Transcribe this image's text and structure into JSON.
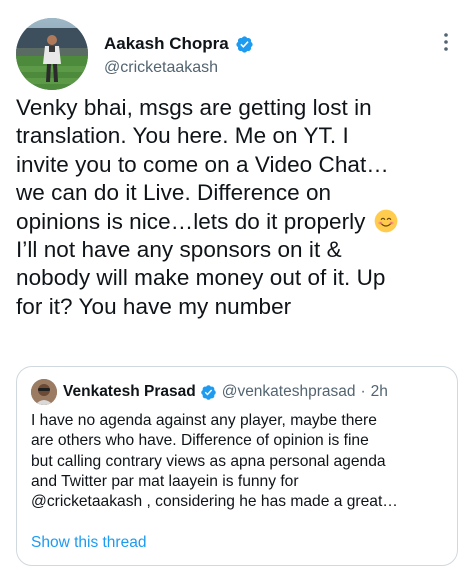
{
  "author": {
    "name": "Aakash Chopra",
    "handle": "@cricketaakash",
    "verified_icon": "verified-badge-icon",
    "more_icon": "more-options-icon"
  },
  "tweet": {
    "lines": [
      "Venky bhai, msgs are getting lost in",
      "translation. You here. Me on YT. I",
      "invite you to come on a Video Chat…",
      "we can do it Live. Difference on",
      "opinions is nice…lets do it properly",
      "I’ll not have any sponsors on it &",
      "nobody will make money out of it. Up",
      "for it? You have my number"
    ],
    "emoji": "smiling-face-emoji"
  },
  "quoted_tweet": {
    "name": "Venkatesh Prasad",
    "handle": "@venkateshprasad",
    "separator": "·",
    "time": "2h",
    "lines": [
      "I have no agenda against any player, maybe there",
      "are others who have. Difference of opinion is fine",
      "but calling contrary views as apna personal agenda",
      "and Twitter par mat laayein is funny for",
      "@cricketaakash , considering he has made a great…"
    ],
    "show_thread": "Show this thread"
  },
  "colors": {
    "text": "#0f1419",
    "secondary": "#536471",
    "accent": "#1d9bf0",
    "border": "#cfd9de"
  }
}
